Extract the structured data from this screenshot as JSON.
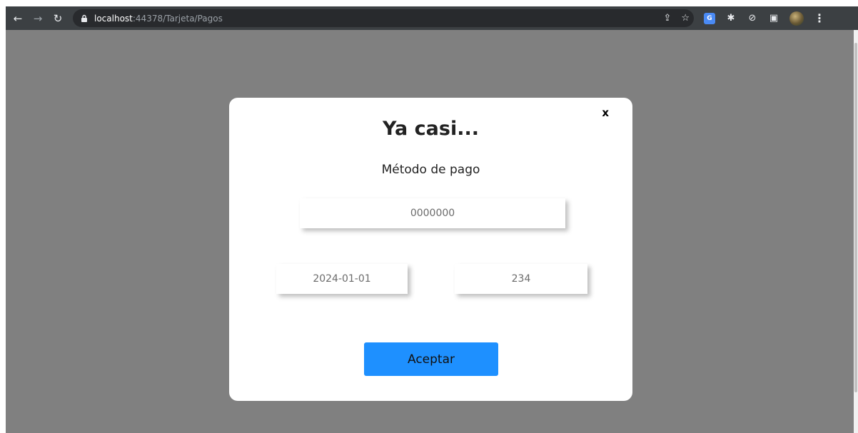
{
  "browser": {
    "url_host": "localhost",
    "url_rest": ":44378/Tarjeta/Pagos"
  },
  "modal": {
    "close_label": "x",
    "title": "Ya casi...",
    "subtitle": "Método de pago",
    "card_number_placeholder": "0000000",
    "expiry_placeholder": "2024-01-01",
    "cvv_placeholder": "234",
    "accept_label": "Aceptar"
  },
  "colors": {
    "overlay": "#808080",
    "button": "#1e90ff",
    "toolbar": "#3c4043"
  }
}
